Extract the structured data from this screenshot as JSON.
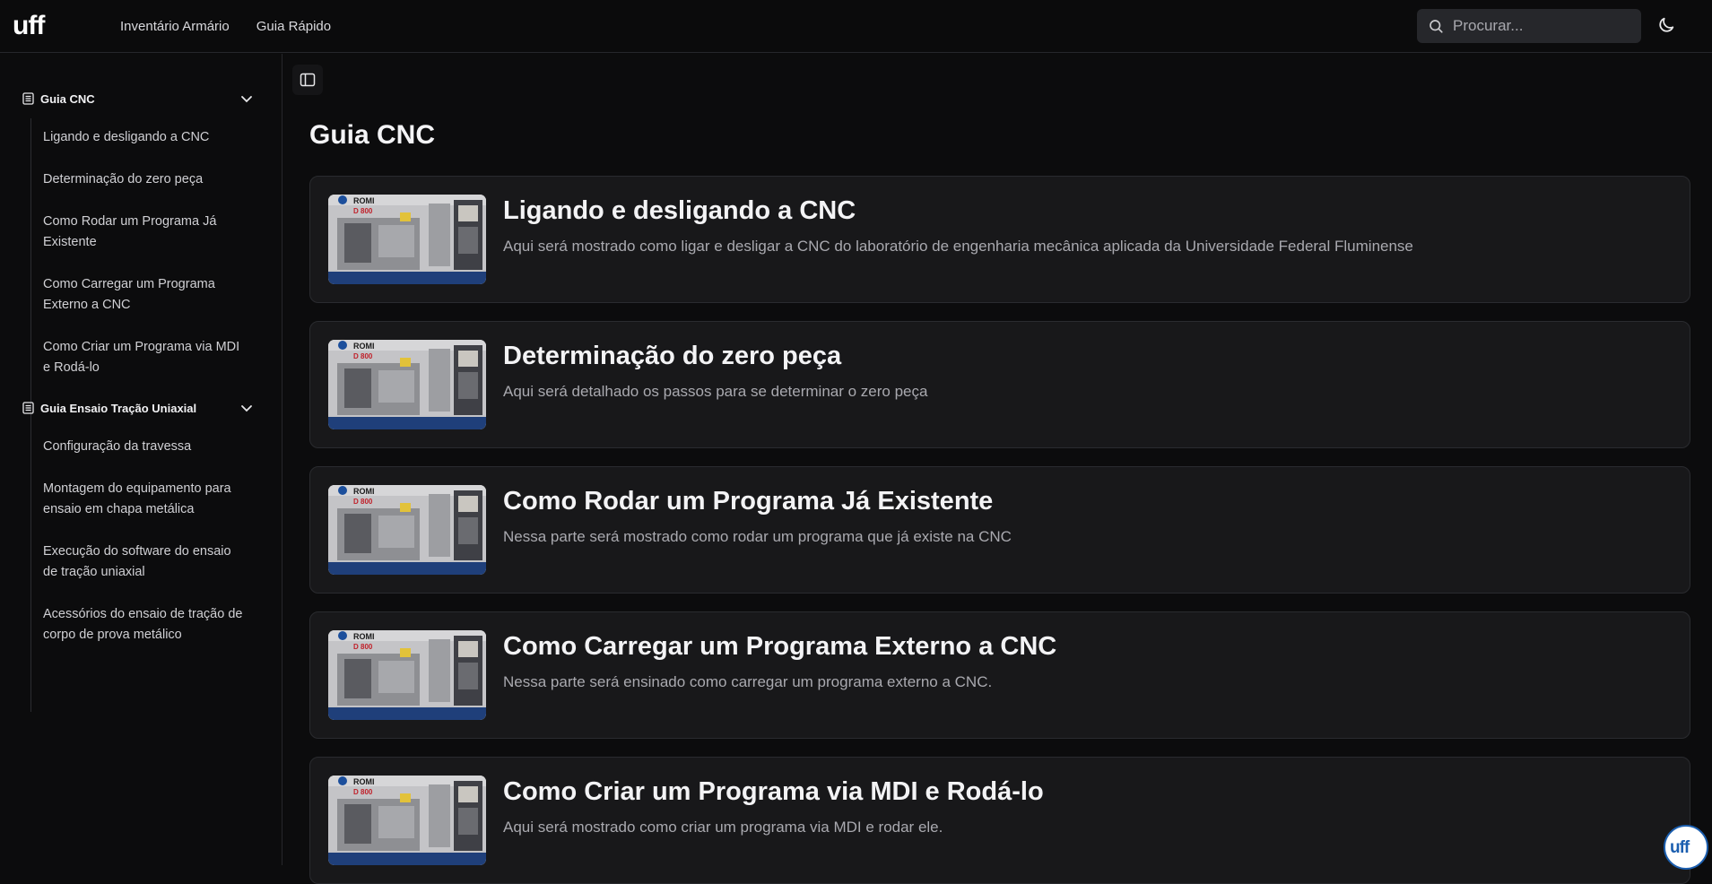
{
  "header": {
    "logo_text": "uff",
    "nav": [
      "Inventário Armário",
      "Guia Rápido"
    ],
    "search_placeholder": "Procurar..."
  },
  "sidebar": {
    "groups": [
      {
        "title": "Guia CNC",
        "items": [
          "Ligando e desligando a CNC",
          "Determinação do zero peça",
          "Como Rodar um Programa Já Existente",
          "Como Carregar um Programa Externo a CNC",
          "Como Criar um Programa via MDI e Rodá-lo"
        ]
      },
      {
        "title": "Guia Ensaio Tração Uniaxial",
        "items": [
          "Configuração da travessa",
          "Montagem do equipamento para ensaio em chapa metálica",
          "Execução do software do ensaio de tração uniaxial",
          "Acessórios do ensaio de tração de corpo de prova metálico"
        ]
      }
    ]
  },
  "main": {
    "title": "Guia CNC",
    "thumb_brand": "ROMI",
    "thumb_model": "D 800",
    "cards": [
      {
        "title": "Ligando e desligando a CNC",
        "desc": "Aqui será mostrado como ligar e desligar a CNC do laboratório de engenharia mecânica aplicada da Universidade Federal Fluminense"
      },
      {
        "title": "Determinação do zero peça",
        "desc": "Aqui será detalhado os passos para se determinar o zero peça"
      },
      {
        "title": "Como Rodar um Programa Já Existente",
        "desc": "Nessa parte será mostrado como rodar um programa que já existe na CNC"
      },
      {
        "title": "Como Carregar um Programa Externo a CNC",
        "desc": "Nessa parte será ensinado como carregar um programa externo a CNC."
      },
      {
        "title": "Como Criar um Programa via MDI e Rodá-lo",
        "desc": "Aqui será mostrado como criar um programa via MDI e rodar ele."
      }
    ]
  },
  "icons": {
    "search": "search-icon",
    "theme": "moon-icon",
    "sidebar_toggle": "sidebar-toggle-icon",
    "group": "document-icon",
    "chevron": "chevron-down-icon"
  },
  "colors": {
    "background": "#0c0c0d",
    "card": "#18181a",
    "accent": "#1c5fb0"
  }
}
